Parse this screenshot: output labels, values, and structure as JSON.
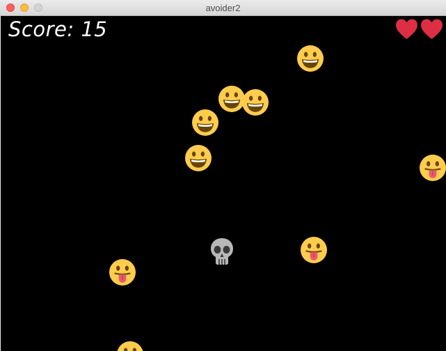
{
  "window": {
    "title": "avoider2"
  },
  "hud": {
    "score_text": "Score: 15",
    "lives": 2
  },
  "colors": {
    "background": "#000000",
    "score_text": "#ffffff",
    "heart": "#dd2e44",
    "emoji_face": "#ffcc4d",
    "emoji_features": "#664500",
    "tongue": "#e75a70",
    "skull": "#b8b8b8"
  },
  "sprites": {
    "grinning_faces": 6,
    "tongue_faces": 3,
    "skulls": 1
  }
}
